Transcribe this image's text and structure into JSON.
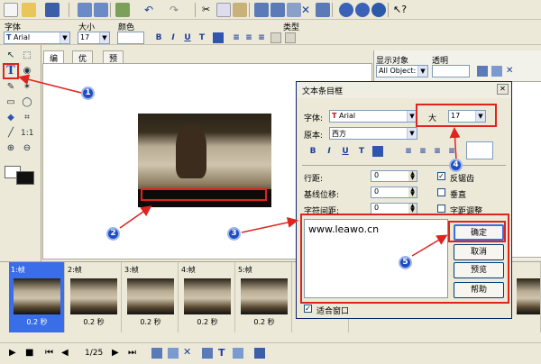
{
  "format_bar": {
    "font_label": "字体",
    "font_value": "Arial",
    "size_label": "大小",
    "size_value": "17",
    "color_label": "颜色",
    "type_label": "类型"
  },
  "tabs": [
    "编辑",
    "优化",
    "预览"
  ],
  "right_panel": {
    "display_label": "显示对象",
    "display_value": "All Object:",
    "opacity_label": "透明"
  },
  "dialog": {
    "title": "文本条目框",
    "font_label": "字体:",
    "font_value": "Arial",
    "size_label": "大",
    "size_value": "17",
    "script_label": "原本:",
    "script_value": "西方",
    "row_spacing_label": "行距:",
    "baseline_label": "基线位移:",
    "char_spacing_label": "字符间距:",
    "row_spacing_value": "0",
    "baseline_value": "0",
    "char_spacing_value": "0",
    "antialias_label": "反锯齿",
    "vertical_label": "垂直",
    "kerning_label": "字距调整",
    "text_value": "www.leawo.cn",
    "ok_label": "确定",
    "cancel_label": "取消",
    "preview_label": "预览",
    "help_label": "帮助",
    "fit_window_label": "适合窗口"
  },
  "frames": [
    {
      "num": "1:帧",
      "dur": "0.2 秒"
    },
    {
      "num": "2:帧",
      "dur": "0.2 秒"
    },
    {
      "num": "3:帧",
      "dur": "0.2 秒"
    },
    {
      "num": "4:帧",
      "dur": "0.2 秒"
    },
    {
      "num": "5:帧",
      "dur": "0.2 秒"
    }
  ],
  "frame_counter": "1/25",
  "callouts": [
    "1",
    "2",
    "3",
    "4",
    "5"
  ],
  "colors": {
    "highlight": "#e0231e",
    "callout": "#1f4fbf",
    "selected_frame": "#3a6ee8"
  }
}
